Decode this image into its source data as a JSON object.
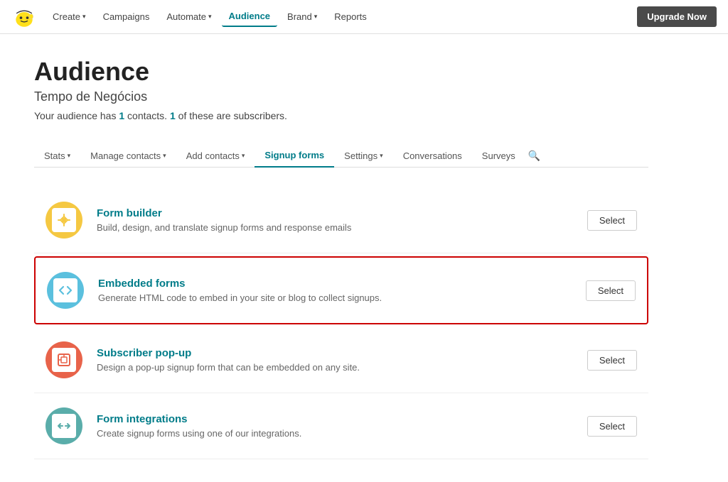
{
  "brand": {
    "logo_alt": "Mailchimp"
  },
  "navbar": {
    "items": [
      {
        "label": "Create",
        "has_dropdown": true,
        "active": false
      },
      {
        "label": "Campaigns",
        "has_dropdown": false,
        "active": false
      },
      {
        "label": "Automate",
        "has_dropdown": true,
        "active": false
      },
      {
        "label": "Audience",
        "has_dropdown": false,
        "active": true
      },
      {
        "label": "Brand",
        "has_dropdown": true,
        "active": false
      },
      {
        "label": "Reports",
        "has_dropdown": false,
        "active": false
      }
    ],
    "upgrade_label": "Upgrade Now"
  },
  "page": {
    "title": "Audience",
    "audience_name": "Tempo de Negócios",
    "info_prefix": "Your audience has ",
    "contacts_count": "1",
    "info_middle": " contacts. ",
    "subscribers_count": "1",
    "info_suffix": " of these are subscribers."
  },
  "sub_nav": {
    "items": [
      {
        "label": "Stats",
        "has_dropdown": true,
        "active": false
      },
      {
        "label": "Manage contacts",
        "has_dropdown": true,
        "active": false
      },
      {
        "label": "Add contacts",
        "has_dropdown": true,
        "active": false
      },
      {
        "label": "Signup forms",
        "has_dropdown": false,
        "active": true
      },
      {
        "label": "Settings",
        "has_dropdown": true,
        "active": false
      },
      {
        "label": "Conversations",
        "has_dropdown": false,
        "active": false
      },
      {
        "label": "Surveys",
        "has_dropdown": false,
        "active": false
      }
    ],
    "search_icon": "🔍"
  },
  "forms": [
    {
      "id": "form-builder",
      "name": "Form builder",
      "description": "Build, design, and translate signup forms and response emails",
      "icon_color": "yellow",
      "icon_symbol": "🔗",
      "select_label": "Select",
      "highlighted": false
    },
    {
      "id": "embedded-forms",
      "name": "Embedded forms",
      "description": "Generate HTML code to embed in your site or blog to collect signups.",
      "icon_color": "blue",
      "icon_symbol": "</>",
      "select_label": "Select",
      "highlighted": true
    },
    {
      "id": "subscriber-popup",
      "name": "Subscriber pop-up",
      "description": "Design a pop-up signup form that can be embedded on any site.",
      "icon_color": "red-orange",
      "icon_symbol": "⧉",
      "select_label": "Select",
      "highlighted": false
    },
    {
      "id": "form-integrations",
      "name": "Form integrations",
      "description": "Create signup forms using one of our integrations.",
      "icon_color": "teal",
      "icon_symbol": "⇄",
      "select_label": "Select",
      "highlighted": false
    }
  ]
}
